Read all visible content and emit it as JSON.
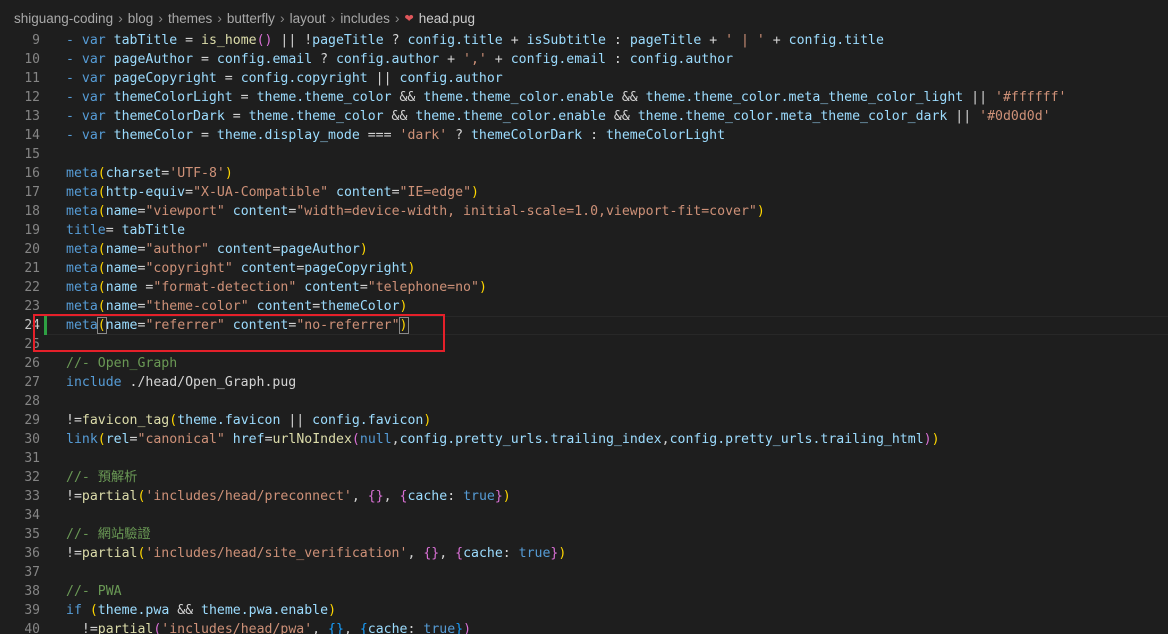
{
  "breadcrumb": {
    "items": [
      "shiguang-coding",
      "blog",
      "themes",
      "butterfly",
      "layout",
      "includes"
    ],
    "file": "head.pug",
    "file_icon": "pug-file-icon"
  },
  "editor": {
    "active_line": 24,
    "highlight_color": "#e5202a",
    "lines": [
      {
        "n": "9",
        "t": [
          [
            "k",
            "- var "
          ],
          [
            "v",
            "tabTitle"
          ],
          [
            "p",
            " = "
          ],
          [
            "f",
            "is_home"
          ],
          [
            "b2",
            "()"
          ],
          [
            "p",
            " || !"
          ],
          [
            "v",
            "pageTitle"
          ],
          [
            "p",
            " ? "
          ],
          [
            "v",
            "config.title"
          ],
          [
            "p",
            " + "
          ],
          [
            "v",
            "isSubtitle"
          ],
          [
            "p",
            " : "
          ],
          [
            "v",
            "pageTitle"
          ],
          [
            "p",
            " + "
          ],
          [
            "s",
            "' | '"
          ],
          [
            "p",
            " + "
          ],
          [
            "v",
            "config.title"
          ]
        ]
      },
      {
        "n": "10",
        "t": [
          [
            "k",
            "- var "
          ],
          [
            "v",
            "pageAuthor"
          ],
          [
            "p",
            " = "
          ],
          [
            "v",
            "config.email"
          ],
          [
            "p",
            " ? "
          ],
          [
            "v",
            "config.author"
          ],
          [
            "p",
            " + "
          ],
          [
            "s",
            "','"
          ],
          [
            "p",
            " + "
          ],
          [
            "v",
            "config.email"
          ],
          [
            "p",
            " : "
          ],
          [
            "v",
            "config.author"
          ]
        ]
      },
      {
        "n": "11",
        "t": [
          [
            "k",
            "- var "
          ],
          [
            "v",
            "pageCopyright"
          ],
          [
            "p",
            " = "
          ],
          [
            "v",
            "config.copyright"
          ],
          [
            "p",
            " || "
          ],
          [
            "v",
            "config.author"
          ]
        ]
      },
      {
        "n": "12",
        "t": [
          [
            "k",
            "- var "
          ],
          [
            "v",
            "themeColorLight"
          ],
          [
            "p",
            " = "
          ],
          [
            "v",
            "theme.theme_color"
          ],
          [
            "p",
            " && "
          ],
          [
            "v",
            "theme.theme_color.enable"
          ],
          [
            "p",
            " && "
          ],
          [
            "v",
            "theme.theme_color.meta_theme_color_light"
          ],
          [
            "p",
            " || "
          ],
          [
            "s",
            "'#ffffff'"
          ]
        ]
      },
      {
        "n": "13",
        "t": [
          [
            "k",
            "- var "
          ],
          [
            "v",
            "themeColorDark"
          ],
          [
            "p",
            " = "
          ],
          [
            "v",
            "theme.theme_color"
          ],
          [
            "p",
            " && "
          ],
          [
            "v",
            "theme.theme_color.enable"
          ],
          [
            "p",
            " && "
          ],
          [
            "v",
            "theme.theme_color.meta_theme_color_dark"
          ],
          [
            "p",
            " || "
          ],
          [
            "s",
            "'#0d0d0d'"
          ]
        ]
      },
      {
        "n": "14",
        "t": [
          [
            "k",
            "- var "
          ],
          [
            "v",
            "themeColor"
          ],
          [
            "p",
            " = "
          ],
          [
            "v",
            "theme.display_mode"
          ],
          [
            "p",
            " === "
          ],
          [
            "s",
            "'dark'"
          ],
          [
            "p",
            " ? "
          ],
          [
            "v",
            "themeColorDark"
          ],
          [
            "p",
            " : "
          ],
          [
            "v",
            "themeColorLight"
          ]
        ]
      },
      {
        "n": "15",
        "t": []
      },
      {
        "n": "16",
        "t": [
          [
            "k",
            "meta"
          ],
          [
            "b1",
            "("
          ],
          [
            "v",
            "charset"
          ],
          [
            "p",
            "="
          ],
          [
            "s",
            "'UTF-8'"
          ],
          [
            "b1",
            ")"
          ]
        ]
      },
      {
        "n": "17",
        "t": [
          [
            "k",
            "meta"
          ],
          [
            "b1",
            "("
          ],
          [
            "v",
            "http-equiv"
          ],
          [
            "p",
            "="
          ],
          [
            "s",
            "\"X-UA-Compatible\""
          ],
          [
            "p",
            " "
          ],
          [
            "v",
            "content"
          ],
          [
            "p",
            "="
          ],
          [
            "s",
            "\"IE=edge\""
          ],
          [
            "b1",
            ")"
          ]
        ]
      },
      {
        "n": "18",
        "t": [
          [
            "k",
            "meta"
          ],
          [
            "b1",
            "("
          ],
          [
            "v",
            "name"
          ],
          [
            "p",
            "="
          ],
          [
            "s",
            "\"viewport\""
          ],
          [
            "p",
            " "
          ],
          [
            "v",
            "content"
          ],
          [
            "p",
            "="
          ],
          [
            "s",
            "\"width=device-width, initial-scale=1.0,viewport-fit=cover\""
          ],
          [
            "b1",
            ")"
          ]
        ]
      },
      {
        "n": "19",
        "t": [
          [
            "k",
            "title"
          ],
          [
            "p",
            "= "
          ],
          [
            "v",
            "tabTitle"
          ]
        ]
      },
      {
        "n": "20",
        "t": [
          [
            "k",
            "meta"
          ],
          [
            "b1",
            "("
          ],
          [
            "v",
            "name"
          ],
          [
            "p",
            "="
          ],
          [
            "s",
            "\"author\""
          ],
          [
            "p",
            " "
          ],
          [
            "v",
            "content"
          ],
          [
            "p",
            "="
          ],
          [
            "v",
            "pageAuthor"
          ],
          [
            "b1",
            ")"
          ]
        ]
      },
      {
        "n": "21",
        "t": [
          [
            "k",
            "meta"
          ],
          [
            "b1",
            "("
          ],
          [
            "v",
            "name"
          ],
          [
            "p",
            "="
          ],
          [
            "s",
            "\"copyright\""
          ],
          [
            "p",
            " "
          ],
          [
            "v",
            "content"
          ],
          [
            "p",
            "="
          ],
          [
            "v",
            "pageCopyright"
          ],
          [
            "b1",
            ")"
          ]
        ]
      },
      {
        "n": "22",
        "t": [
          [
            "k",
            "meta"
          ],
          [
            "b1",
            "("
          ],
          [
            "v",
            "name"
          ],
          [
            "p",
            " ="
          ],
          [
            "s",
            "\"format-detection\""
          ],
          [
            "p",
            " "
          ],
          [
            "v",
            "content"
          ],
          [
            "p",
            "="
          ],
          [
            "s",
            "\"telephone=no\""
          ],
          [
            "b1",
            ")"
          ]
        ]
      },
      {
        "n": "23",
        "t": [
          [
            "k",
            "meta"
          ],
          [
            "b1",
            "("
          ],
          [
            "v",
            "name"
          ],
          [
            "p",
            "="
          ],
          [
            "s",
            "\"theme-color\""
          ],
          [
            "p",
            " "
          ],
          [
            "v",
            "content"
          ],
          [
            "p",
            "="
          ],
          [
            "v",
            "themeColor"
          ],
          [
            "b1",
            ")"
          ]
        ]
      },
      {
        "n": "24",
        "t": [
          [
            "k",
            "meta"
          ],
          [
            "b1",
            "("
          ],
          [
            "v",
            "name"
          ],
          [
            "p",
            "="
          ],
          [
            "s",
            "\"referrer\""
          ],
          [
            "p",
            " "
          ],
          [
            "v",
            "content"
          ],
          [
            "p",
            "="
          ],
          [
            "s",
            "\"no-referrer\""
          ],
          [
            "b1",
            ")"
          ]
        ]
      },
      {
        "n": "25",
        "t": []
      },
      {
        "n": "26",
        "t": [
          [
            "c",
            "//- Open_Graph"
          ]
        ]
      },
      {
        "n": "27",
        "t": [
          [
            "k",
            "include"
          ],
          [
            "p",
            " ./head/Open_Graph.pug"
          ]
        ]
      },
      {
        "n": "28",
        "t": []
      },
      {
        "n": "29",
        "t": [
          [
            "p",
            "!="
          ],
          [
            "f",
            "favicon_tag"
          ],
          [
            "b1",
            "("
          ],
          [
            "v",
            "theme.favicon"
          ],
          [
            "p",
            " || "
          ],
          [
            "v",
            "config.favicon"
          ],
          [
            "b1",
            ")"
          ]
        ]
      },
      {
        "n": "30",
        "t": [
          [
            "k",
            "link"
          ],
          [
            "b1",
            "("
          ],
          [
            "v",
            "rel"
          ],
          [
            "p",
            "="
          ],
          [
            "s",
            "\"canonical\""
          ],
          [
            "p",
            " "
          ],
          [
            "v",
            "href"
          ],
          [
            "p",
            "="
          ],
          [
            "f",
            "urlNoIndex"
          ],
          [
            "b2",
            "("
          ],
          [
            "k",
            "null"
          ],
          [
            "p",
            ","
          ],
          [
            "v",
            "config.pretty_urls.trailing_index"
          ],
          [
            "p",
            ","
          ],
          [
            "v",
            "config.pretty_urls.trailing_html"
          ],
          [
            "b2",
            ")"
          ],
          [
            "b1",
            ")"
          ]
        ]
      },
      {
        "n": "31",
        "t": []
      },
      {
        "n": "32",
        "t": [
          [
            "c",
            "//- 預解析"
          ]
        ]
      },
      {
        "n": "33",
        "t": [
          [
            "p",
            "!="
          ],
          [
            "f",
            "partial"
          ],
          [
            "b1",
            "("
          ],
          [
            "s",
            "'includes/head/preconnect'"
          ],
          [
            "p",
            ", "
          ],
          [
            "b2",
            "{}"
          ],
          [
            "p",
            ", "
          ],
          [
            "b2",
            "{"
          ],
          [
            "v",
            "cache"
          ],
          [
            "p",
            ": "
          ],
          [
            "k",
            "true"
          ],
          [
            "b2",
            "}"
          ],
          [
            "b1",
            ")"
          ]
        ]
      },
      {
        "n": "34",
        "t": []
      },
      {
        "n": "35",
        "t": [
          [
            "c",
            "//- 網站驗證"
          ]
        ]
      },
      {
        "n": "36",
        "t": [
          [
            "p",
            "!="
          ],
          [
            "f",
            "partial"
          ],
          [
            "b1",
            "("
          ],
          [
            "s",
            "'includes/head/site_verification'"
          ],
          [
            "p",
            ", "
          ],
          [
            "b2",
            "{}"
          ],
          [
            "p",
            ", "
          ],
          [
            "b2",
            "{"
          ],
          [
            "v",
            "cache"
          ],
          [
            "p",
            ": "
          ],
          [
            "k",
            "true"
          ],
          [
            "b2",
            "}"
          ],
          [
            "b1",
            ")"
          ]
        ]
      },
      {
        "n": "37",
        "t": []
      },
      {
        "n": "38",
        "t": [
          [
            "c",
            "//- PWA"
          ]
        ]
      },
      {
        "n": "39",
        "t": [
          [
            "k",
            "if"
          ],
          [
            "p",
            " "
          ],
          [
            "b1",
            "("
          ],
          [
            "v",
            "theme.pwa"
          ],
          [
            "p",
            " && "
          ],
          [
            "v",
            "theme.pwa.enable"
          ],
          [
            "b1",
            ")"
          ]
        ]
      },
      {
        "n": "40",
        "t": [
          [
            "p",
            "  !="
          ],
          [
            "f",
            "partial"
          ],
          [
            "b2",
            "("
          ],
          [
            "s",
            "'includes/head/pwa'"
          ],
          [
            "p",
            ", "
          ],
          [
            "b3",
            "{}"
          ],
          [
            "p",
            ", "
          ],
          [
            "b3",
            "{"
          ],
          [
            "v",
            "cache"
          ],
          [
            "p",
            ": "
          ],
          [
            "k",
            "true"
          ],
          [
            "b3",
            "}"
          ],
          [
            "b2",
            ")"
          ]
        ]
      }
    ]
  }
}
